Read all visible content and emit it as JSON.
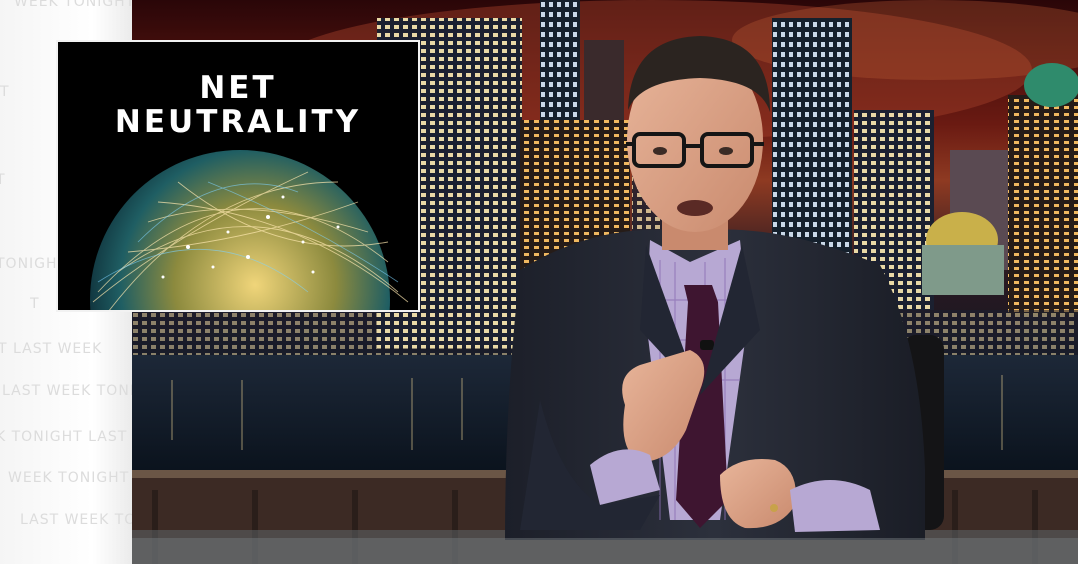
{
  "watermark": {
    "text": "LAST WEEK TONIGHT",
    "fragments": [
      "WEEK TONIGHT",
      "T",
      "TONIGHT",
      "LAST WEEK TONIGHT",
      "WEEK TONIGHT",
      "T",
      "T   LAST WEEK",
      "LAST WEEK TONIGHT",
      "K TONIGHT   LAST",
      "WEEK TONIGHT",
      "LAST WEEK TO"
    ]
  },
  "graphic": {
    "title_line1": "NET",
    "title_line2": "NEUTRALITY",
    "image": "globe-network-image"
  },
  "scene": {
    "background": "city-skyline-night",
    "subject": "host-at-desk",
    "accent_colors": {
      "sky_red": "#8e3a22",
      "suit": "#262a36",
      "tie": "#3e1530",
      "shirt": "#b7a8d3"
    }
  }
}
